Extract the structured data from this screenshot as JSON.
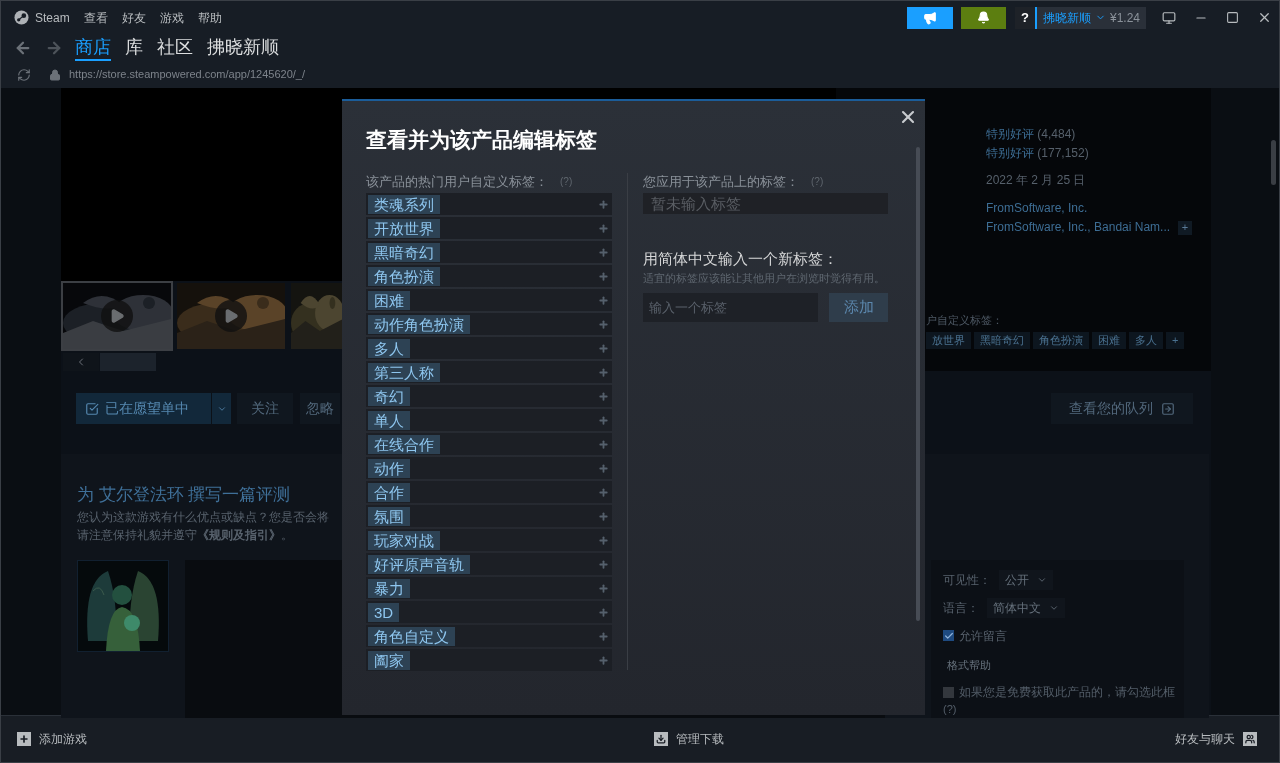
{
  "menu": [
    "Steam",
    "查看",
    "好友",
    "游戏",
    "帮助"
  ],
  "account": {
    "help": "?",
    "name": "拂晓新顺",
    "balance": "¥1.24"
  },
  "nav_tabs": [
    {
      "label": "商店",
      "selected": true
    },
    {
      "label": "库",
      "selected": false
    },
    {
      "label": "社区",
      "selected": false
    },
    {
      "label": "拂晓新顺",
      "selected": false
    }
  ],
  "url": "https://store.steampowered.com/app/1245620/_/",
  "page": {
    "reviews": [
      {
        "rating": "特别好评",
        "count": "(4,484)"
      },
      {
        "rating": "特别好评",
        "count": "(177,152)"
      }
    ],
    "release_date": "2022 年 2 月 25 日",
    "developer": "FromSoftware, Inc.",
    "publisher": "FromSoftware, Inc., Bandai Nam...",
    "more": "+",
    "tags_label": "户自定义标签：",
    "tags": [
      "放世界",
      "黑暗奇幻",
      "角色扮演",
      "困难",
      "多人",
      "+"
    ],
    "wishlist_button": "已在愿望单中",
    "follow_button": "关注",
    "ignore_button": "忽略",
    "queue_button": "查看您的队列",
    "review": {
      "title": "为 艾尔登法环 撰写一篇评测",
      "lines": [
        "您认为这款游戏有什么优点或缺点？您是否会将",
        "请注意保持礼貌并遵守**《规则及指引》**。"
      ],
      "visibility_label": "可见性：",
      "visibility": "公开",
      "language_label": "语言：",
      "language": "简体中文",
      "allow_comments": {
        "label": "允许留言",
        "checked": true
      },
      "format_help": "格式帮助",
      "free": {
        "label": "如果您是免费获取此产品的，请勾选此框",
        "checked": false
      },
      "free_help": "(?)"
    }
  },
  "dialog": {
    "title": "查看并为该产品编辑标签",
    "popular_label": "该产品的热门用户自定义标签：",
    "popular_help": "(?)",
    "popular_tags": [
      "类魂系列",
      "开放世界",
      "黑暗奇幻",
      "角色扮演",
      "困难",
      "动作角色扮演",
      "多人",
      "第三人称",
      "奇幻",
      "单人",
      "在线合作",
      "动作",
      "合作",
      "氛围",
      "玩家对战",
      "好评原声音轨",
      "暴力",
      "3D",
      "角色自定义",
      "阖家"
    ],
    "applied_label": "您应用于该产品上的标签：",
    "applied_help": "(?)",
    "applied_empty": "暂未输入标签",
    "new_tag_title": "用简体中文输入一个新标签：",
    "new_tag_hint": "适宜的标签应该能让其他用户在浏览时觉得有用。",
    "input_placeholder": "输入一个标签",
    "add_button": "添加"
  },
  "bottom_bar": {
    "add_game": "添加游戏",
    "downloads": "管理下载",
    "friends": "好友与聊天"
  }
}
